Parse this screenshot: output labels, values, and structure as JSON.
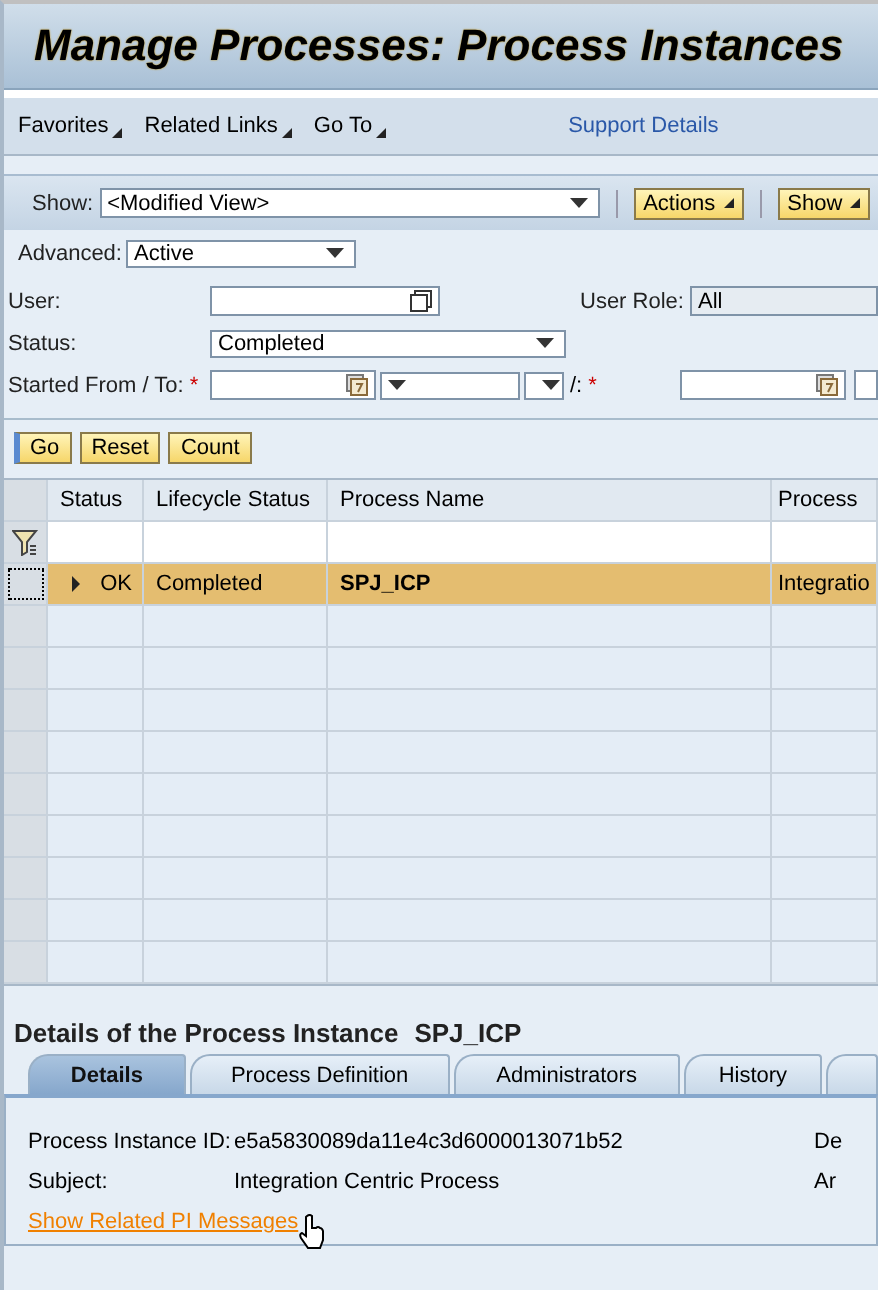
{
  "header": {
    "title": "Manage Processes: Process Instances"
  },
  "toolbar": {
    "menus": [
      "Favorites",
      "Related Links",
      "Go To"
    ],
    "link": "Support Details"
  },
  "view_bar": {
    "label": "Show:",
    "view": "<Modified View>",
    "buttons": [
      "Actions",
      "Show"
    ]
  },
  "filters": {
    "advanced": {
      "label": "Advanced:",
      "value": "Active"
    },
    "user": {
      "label": "User:"
    },
    "user_role": {
      "label": "User Role:",
      "value": "All"
    },
    "status": {
      "label": "Status:",
      "value": "Completed"
    },
    "started": {
      "label": "Started From / To:",
      "required": "*",
      "separator": "/:",
      "required_to": "*"
    }
  },
  "buttons": [
    "Go",
    "Reset",
    "Count"
  ],
  "table": {
    "columns": [
      "Status",
      "Lifecycle Status",
      "Process Name",
      "Process"
    ],
    "rows": [
      {
        "status": "OK",
        "lifecycle": "Completed",
        "name": "SPJ_ICP",
        "process": "Integratio",
        "selected": true
      }
    ]
  },
  "details": {
    "title": "Details of the Process Instance",
    "instance": "SPJ_ICP",
    "tabs": [
      {
        "label": "Details",
        "selected": true
      },
      {
        "label": "Process Definition",
        "selected": false
      },
      {
        "label": "Administrators",
        "selected": false
      },
      {
        "label": "History",
        "selected": false
      }
    ],
    "fields": [
      {
        "label": "Process Instance ID:",
        "value": "e5a5830089da11e4c3d6000013071b52",
        "side": "De"
      },
      {
        "label": "Subject:",
        "value": "Integration Centric Process",
        "side": "Ar"
      }
    ],
    "link": "Show Related PI Messages"
  }
}
